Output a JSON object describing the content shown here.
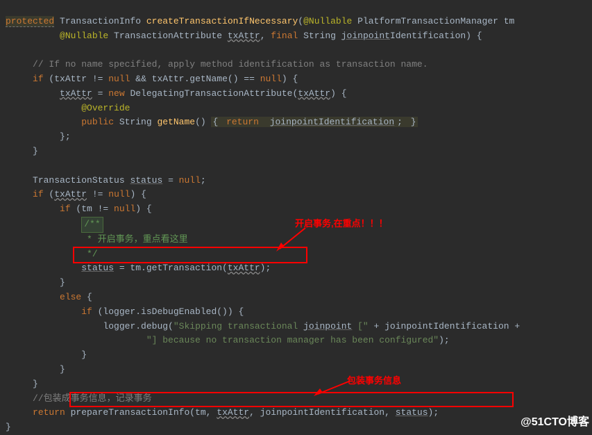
{
  "code": {
    "t1a": "protected",
    "t1b": " TransactionInfo ",
    "t1c": "createTransactionIfNecessary",
    "t1d": "(",
    "t1e": "@Nullable",
    "t1f": " PlatformTransactionManager tm",
    "t2a": "@Nullable",
    "t2b": " TransactionAttribute ",
    "t2c": "txAttr",
    "t2d": ", ",
    "t2e": "final",
    "t2f": " String ",
    "t2g": "joinpoint",
    "t2h": "Identification) {",
    "t3": "// If no name specified, apply method identification as transaction name.",
    "t4a": "if",
    "t4b": " (txAttr != ",
    "t4c": "null",
    "t4d": " && txAttr.getName() == ",
    "t4e": "null",
    "t4f": ") {",
    "t5a": "txAttr",
    "t5b": " = ",
    "t5c": "new",
    "t5d": " DelegatingTransactionAttribute(",
    "t5e": "txAttr",
    "t5f": ") {",
    "t6": "@Override",
    "t7a": "public",
    "t7b": " String ",
    "t7c": "getName",
    "t7d": "() ",
    "t7e": "{ ",
    "t7f": "return",
    "t7g": " ",
    "t7h": "joinpointIdentification",
    "t7i": "; ",
    "t7j": "}",
    "t8": "};",
    "t9": "}",
    "t10a": "TransactionStatus ",
    "t10b": "status",
    "t10c": " = ",
    "t10d": "null",
    "t10e": ";",
    "t11a": "if",
    "t11b": " (",
    "t11c": "txAttr",
    "t11d": " != ",
    "t11e": "null",
    "t11f": ") {",
    "t12a": "if",
    "t12b": " (tm != ",
    "t12c": "null",
    "t12d": ") {",
    "t13": "/**",
    "t14": " * 开启事务，重点看这里",
    "t15": " */",
    "t16a": "status",
    "t16b": " = tm.getTransaction(",
    "t16c": "txAttr",
    "t16d": ");",
    "t17": "}",
    "t18a": "else",
    "t18b": " {",
    "t19a": "if",
    "t19b": " (logger.isDebugEnabled()) {",
    "t20a": "logger.debug(",
    "t20b": "\"Skipping transactional ",
    "t20c": "joinpoint",
    "t20d": " [\"",
    "t20e": " + joinpointIdentification +",
    "t21": "\"] because no transaction manager has been configured\"",
    "t21b": ");",
    "t22": "}",
    "t23": "}",
    "t24": "}",
    "t25": "//包装成事务信息，记录事务",
    "t26a": "return",
    "t26b": " prepareTransactionInfo(tm, ",
    "t26c": "txAttr",
    "t26d": ", joinpointIdentification, ",
    "t26e": "status",
    "t26f": ");",
    "t27": "}"
  },
  "annotations": {
    "label1": "开启事务,在重点！！！",
    "label2": "包装事务信息"
  },
  "watermark": "@51CTO博客"
}
